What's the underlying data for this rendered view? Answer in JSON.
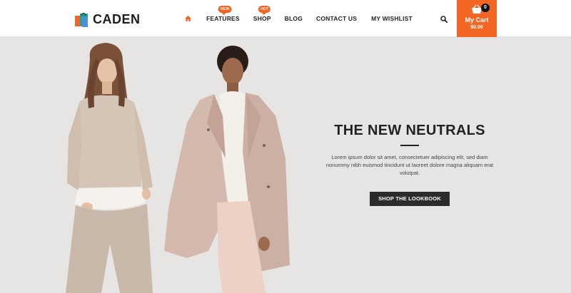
{
  "brand": {
    "name": "CADEN",
    "icon": "shopping-bags-icon"
  },
  "nav": {
    "home_icon": "home-icon",
    "items": [
      {
        "label": "FEATURES",
        "badge": "NEW"
      },
      {
        "label": "SHOP",
        "badge": "HOT"
      },
      {
        "label": "BLOG"
      },
      {
        "label": "CONTACT US"
      },
      {
        "label": "MY WISHLIST"
      }
    ]
  },
  "search": {
    "icon": "search-icon"
  },
  "cart": {
    "icon": "basket-icon",
    "count": "0",
    "label": "My Cart",
    "total": "$0.00"
  },
  "hero": {
    "title": "THE NEW NEUTRALS",
    "body": "Lorem ipsum dolor sit amet, consectetuer adipiscing elit, sed diam nonummy nibh euismod tincidunt ut laoreet dolore magna aliquam erat volutpat.",
    "cta": "SHOP THE LOOKBOOK"
  },
  "colors": {
    "accent": "#f26522",
    "dark": "#2b2b2b",
    "hero_bg": "#e7e5e4"
  }
}
